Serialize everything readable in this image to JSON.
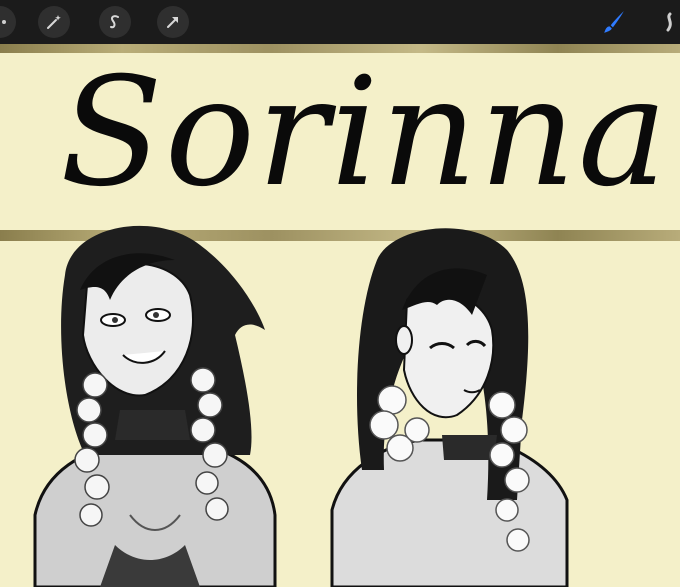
{
  "canvas": {
    "title_text": "Sorinna",
    "background": "#f4f0c9",
    "band_color": "#a89c68"
  },
  "toolbar": {
    "background": "#1b1b1b",
    "tools": [
      {
        "icon": "magic-wand-icon"
      },
      {
        "icon": "selection-s-icon"
      },
      {
        "icon": "transform-arrow-icon"
      },
      {
        "icon": "brush-icon",
        "active_color": "#2f7bff"
      },
      {
        "icon": "smudge-icon"
      }
    ]
  }
}
